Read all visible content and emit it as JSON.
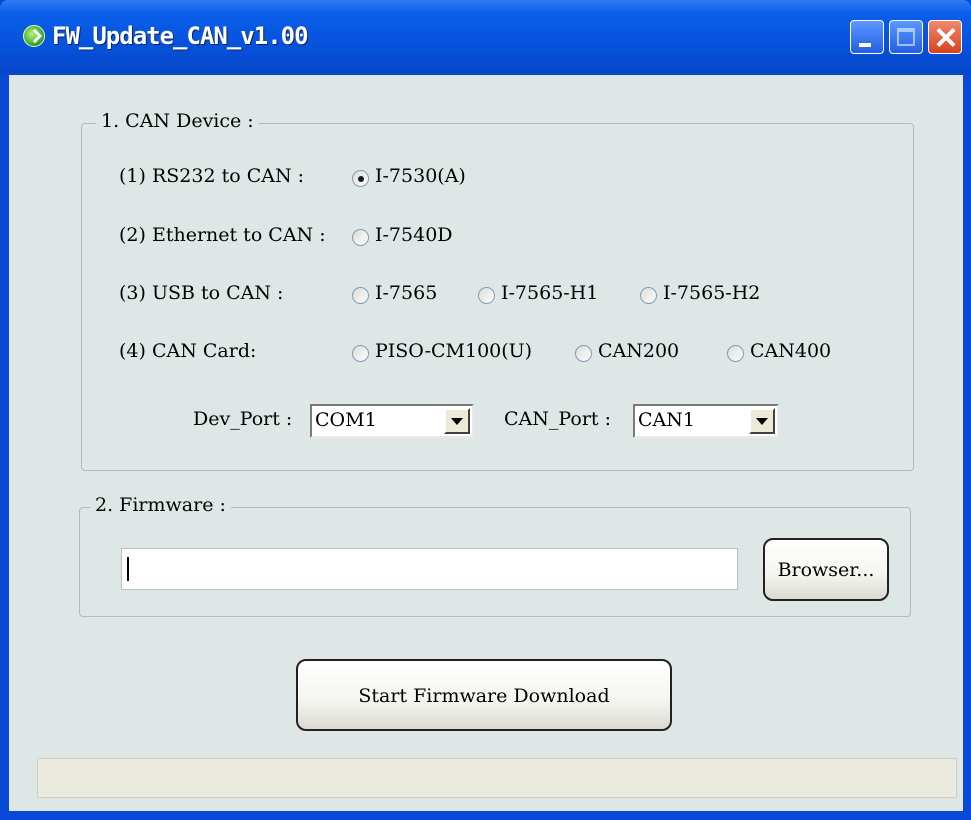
{
  "window": {
    "title": "FW_Update_CAN_v1.00"
  },
  "can_device": {
    "legend": "1. CAN Device :",
    "rows": [
      {
        "label": "(1) RS232 to CAN :",
        "options": [
          "I-7530(A)"
        ]
      },
      {
        "label": "(2) Ethernet to CAN :",
        "options": [
          "I-7540D"
        ]
      },
      {
        "label": "(3) USB to CAN :",
        "options": [
          "I-7565",
          "I-7565-H1",
          "I-7565-H2"
        ]
      },
      {
        "label": "(4) CAN Card:",
        "options": [
          "PISO-CM100(U)",
          "CAN200",
          "CAN400"
        ]
      }
    ],
    "selected": "I-7530(A)",
    "dev_port": {
      "label": "Dev_Port :",
      "value": "COM1"
    },
    "can_port": {
      "label": "CAN_Port :",
      "value": "CAN1"
    }
  },
  "firmware": {
    "legend": "2. Firmware :",
    "path_value": "",
    "browse_label": "Browser..."
  },
  "actions": {
    "start_label": "Start Firmware Download"
  },
  "status": {
    "text": ""
  },
  "colors": {
    "titlebar": "#0752dc",
    "client": "#dfe6e6",
    "status": "#ebeadf"
  },
  "icons": {
    "app": "green-arrow-icon",
    "minimize": "minimize-icon",
    "maximize": "maximize-icon",
    "close": "close-icon"
  }
}
